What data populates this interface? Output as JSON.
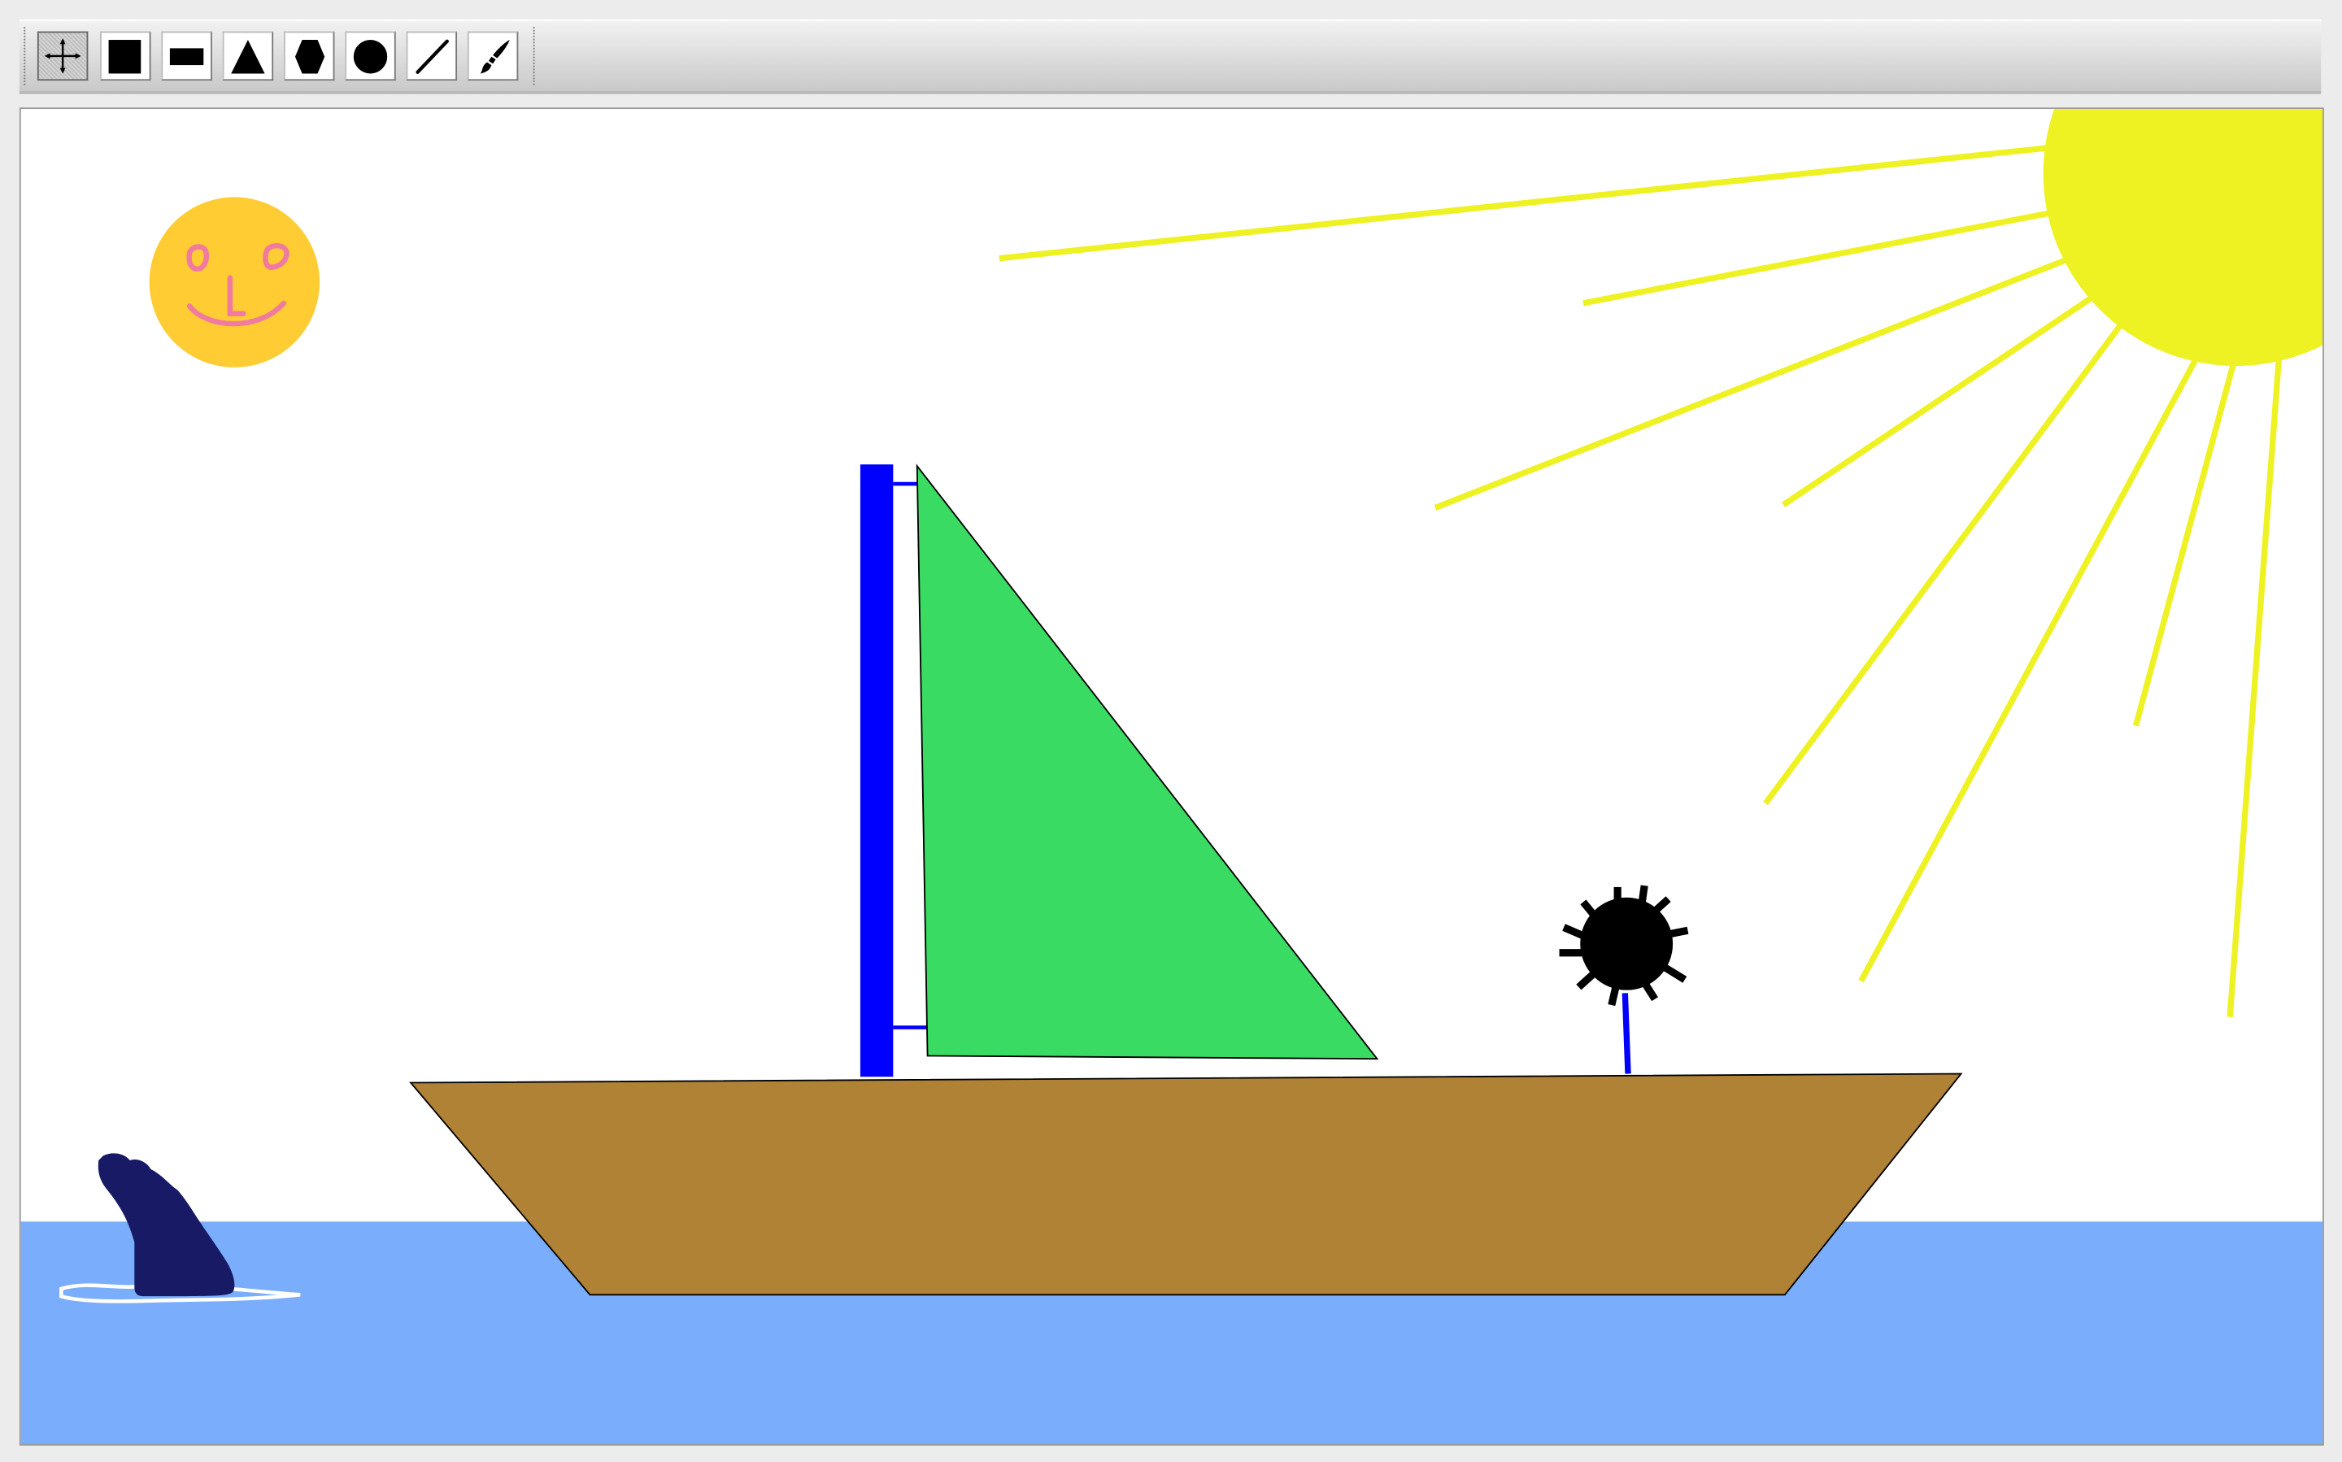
{
  "toolbar": {
    "tools": [
      {
        "name": "move-icon",
        "active": true
      },
      {
        "name": "rectangle-icon",
        "active": false
      },
      {
        "name": "wide-rectangle-icon",
        "active": false
      },
      {
        "name": "triangle-icon",
        "active": false
      },
      {
        "name": "hexagon-icon",
        "active": false
      },
      {
        "name": "ellipse-icon",
        "active": false
      },
      {
        "name": "line-icon",
        "active": false
      },
      {
        "name": "brush-icon",
        "active": false
      }
    ]
  },
  "colors": {
    "sky": "#ffffff",
    "water": "#7aaefc",
    "sun": "#eef222",
    "smiley": "#ffcc33",
    "smiley_features": "#f07aa0",
    "mast": "#0000ff",
    "sail": "#3adb62",
    "hull": "#b08236",
    "whale": "#181a66",
    "mine": "#000000"
  }
}
